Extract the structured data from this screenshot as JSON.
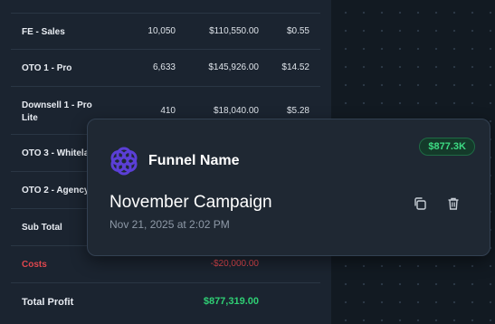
{
  "table": {
    "rows": [
      {
        "name": "FE - Sales",
        "c1": "10,050",
        "c2": "$110,550.00",
        "c3": "$0.55"
      },
      {
        "name": "OTO 1 - Pro",
        "c1": "6,633",
        "c2": "$145,926.00",
        "c3": "$14.52"
      },
      {
        "name": "Downsell 1 - Pro Lite",
        "c1": "410",
        "c2": "$18,040.00",
        "c3": "$5.28"
      },
      {
        "name": "OTO 3 - Whitela",
        "c1": "",
        "c2": "",
        "c3": ""
      },
      {
        "name": "OTO 2 - Agency",
        "c1": "",
        "c2": "",
        "c3": ""
      },
      {
        "name": "Sub Total",
        "c1": "",
        "c2": "",
        "c3": ""
      },
      {
        "name": "Costs",
        "c1": "",
        "c2": "-$20,000.00",
        "c3": ""
      },
      {
        "name": "Total Profit",
        "c1": "",
        "c2": "$877,319.00",
        "c3": ""
      }
    ]
  },
  "card": {
    "badge": "$877.3K",
    "funnel_label": "Funnel Name",
    "campaign_name": "November Campaign",
    "date": "Nov 21, 2025 at 2:02 PM",
    "logo_icon": "hexagon-flower-icon",
    "copy_icon": "copy-icon",
    "delete_icon": "trash-icon"
  },
  "colors": {
    "accent": "#5b3fd6",
    "profit": "#2fcf74",
    "cost": "#e0474e",
    "badge_text": "#3ddc84"
  }
}
